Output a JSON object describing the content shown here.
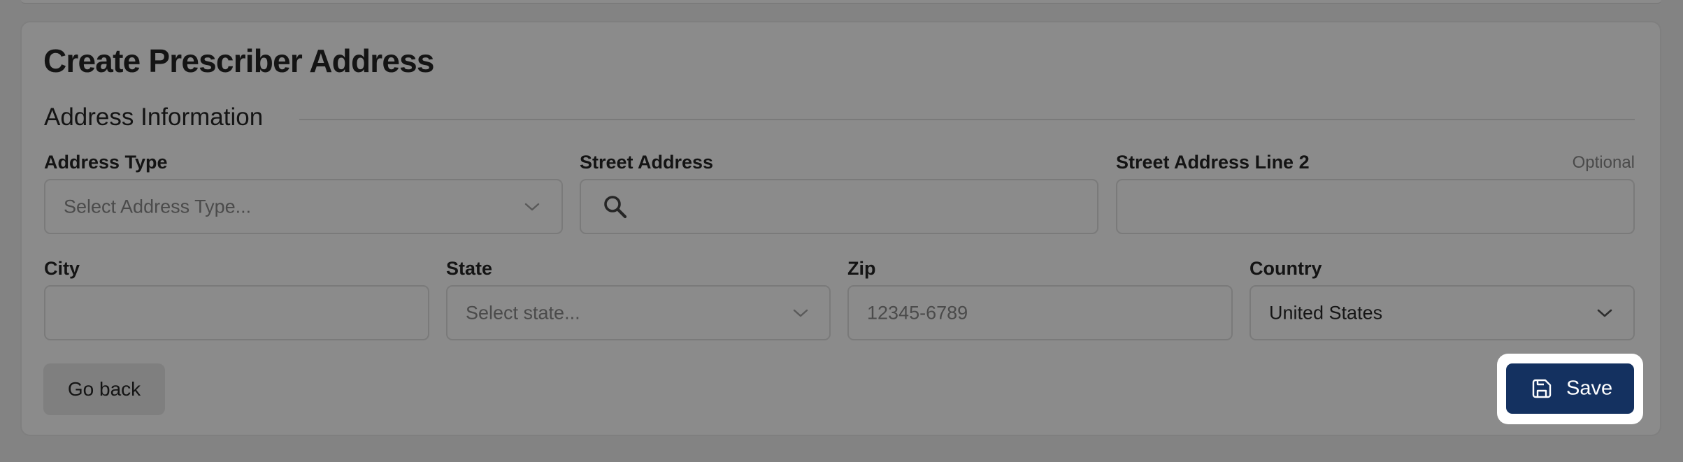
{
  "page": {
    "title": "Create Prescriber Address"
  },
  "section": {
    "title": "Address Information"
  },
  "fields": {
    "address_type": {
      "label": "Address Type",
      "placeholder": "Select Address Type..."
    },
    "street_address": {
      "label": "Street Address",
      "value": ""
    },
    "street_address_2": {
      "label": "Street Address Line 2",
      "optional": "Optional",
      "value": ""
    },
    "city": {
      "label": "City",
      "value": ""
    },
    "state": {
      "label": "State",
      "placeholder": "Select state..."
    },
    "zip": {
      "label": "Zip",
      "placeholder": "12345-6789"
    },
    "country": {
      "label": "Country",
      "value": "United States"
    }
  },
  "buttons": {
    "back_label": "Go back",
    "save_label": "Save"
  },
  "icons": {
    "search": "search-icon",
    "chevron": "chevron-down-icon",
    "save": "save-icon"
  },
  "colors": {
    "overlay_background": "#838383",
    "primary": "#143160",
    "highlight_frame": "#ffffff"
  }
}
